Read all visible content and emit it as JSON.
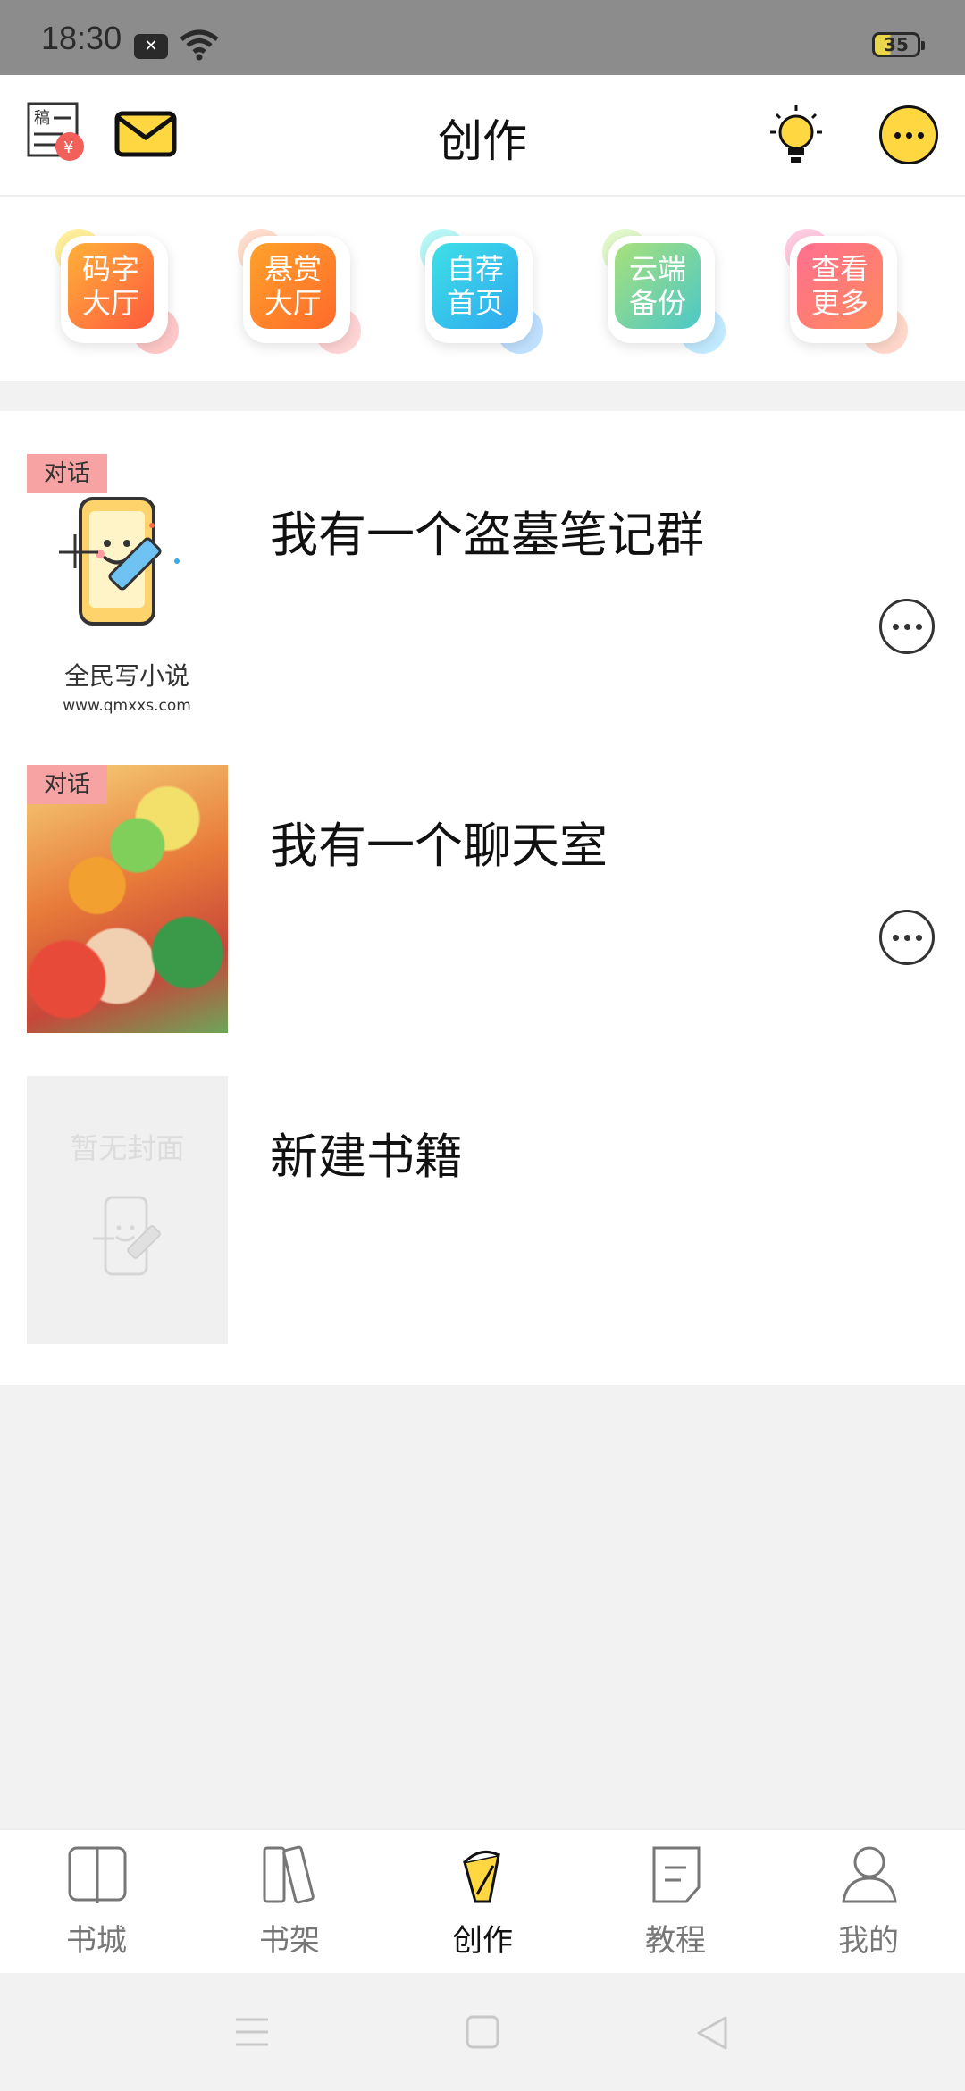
{
  "status_bar": {
    "time": "18:30",
    "battery": "35"
  },
  "header": {
    "title": "创作"
  },
  "quick_actions": [
    {
      "line1": "码字",
      "line2": "大厅",
      "color": "#ff6a3d"
    },
    {
      "line1": "悬赏",
      "line2": "大厅",
      "color": "#ff7a2a"
    },
    {
      "line1": "自荐",
      "line2": "首页",
      "color": "#2ec2f0"
    },
    {
      "line1": "云端",
      "line2": "备份",
      "color": "#6fd4a4"
    },
    {
      "line1": "查看",
      "line2": "更多",
      "color": "#f2607a"
    }
  ],
  "books": [
    {
      "tag": "对话",
      "title": "我有一个盗墓笔记群",
      "cover_caption": "全民写小说",
      "cover_url": "www.qmxxs.com"
    },
    {
      "tag": "对话",
      "title": "我有一个聊天室"
    },
    {
      "title": "新建书籍",
      "cover_placeholder": "暂无封面"
    }
  ],
  "bottom_nav": [
    {
      "label": "书城",
      "icon": "book-open-icon"
    },
    {
      "label": "书架",
      "icon": "bookshelf-icon"
    },
    {
      "label": "创作",
      "icon": "pen-cup-icon",
      "active": true
    },
    {
      "label": "教程",
      "icon": "document-icon"
    },
    {
      "label": "我的",
      "icon": "person-icon"
    }
  ],
  "colors": {
    "accent_yellow": "#ffd740",
    "tag_pink": "#f7a3a3",
    "background": "#f2f2f2"
  }
}
